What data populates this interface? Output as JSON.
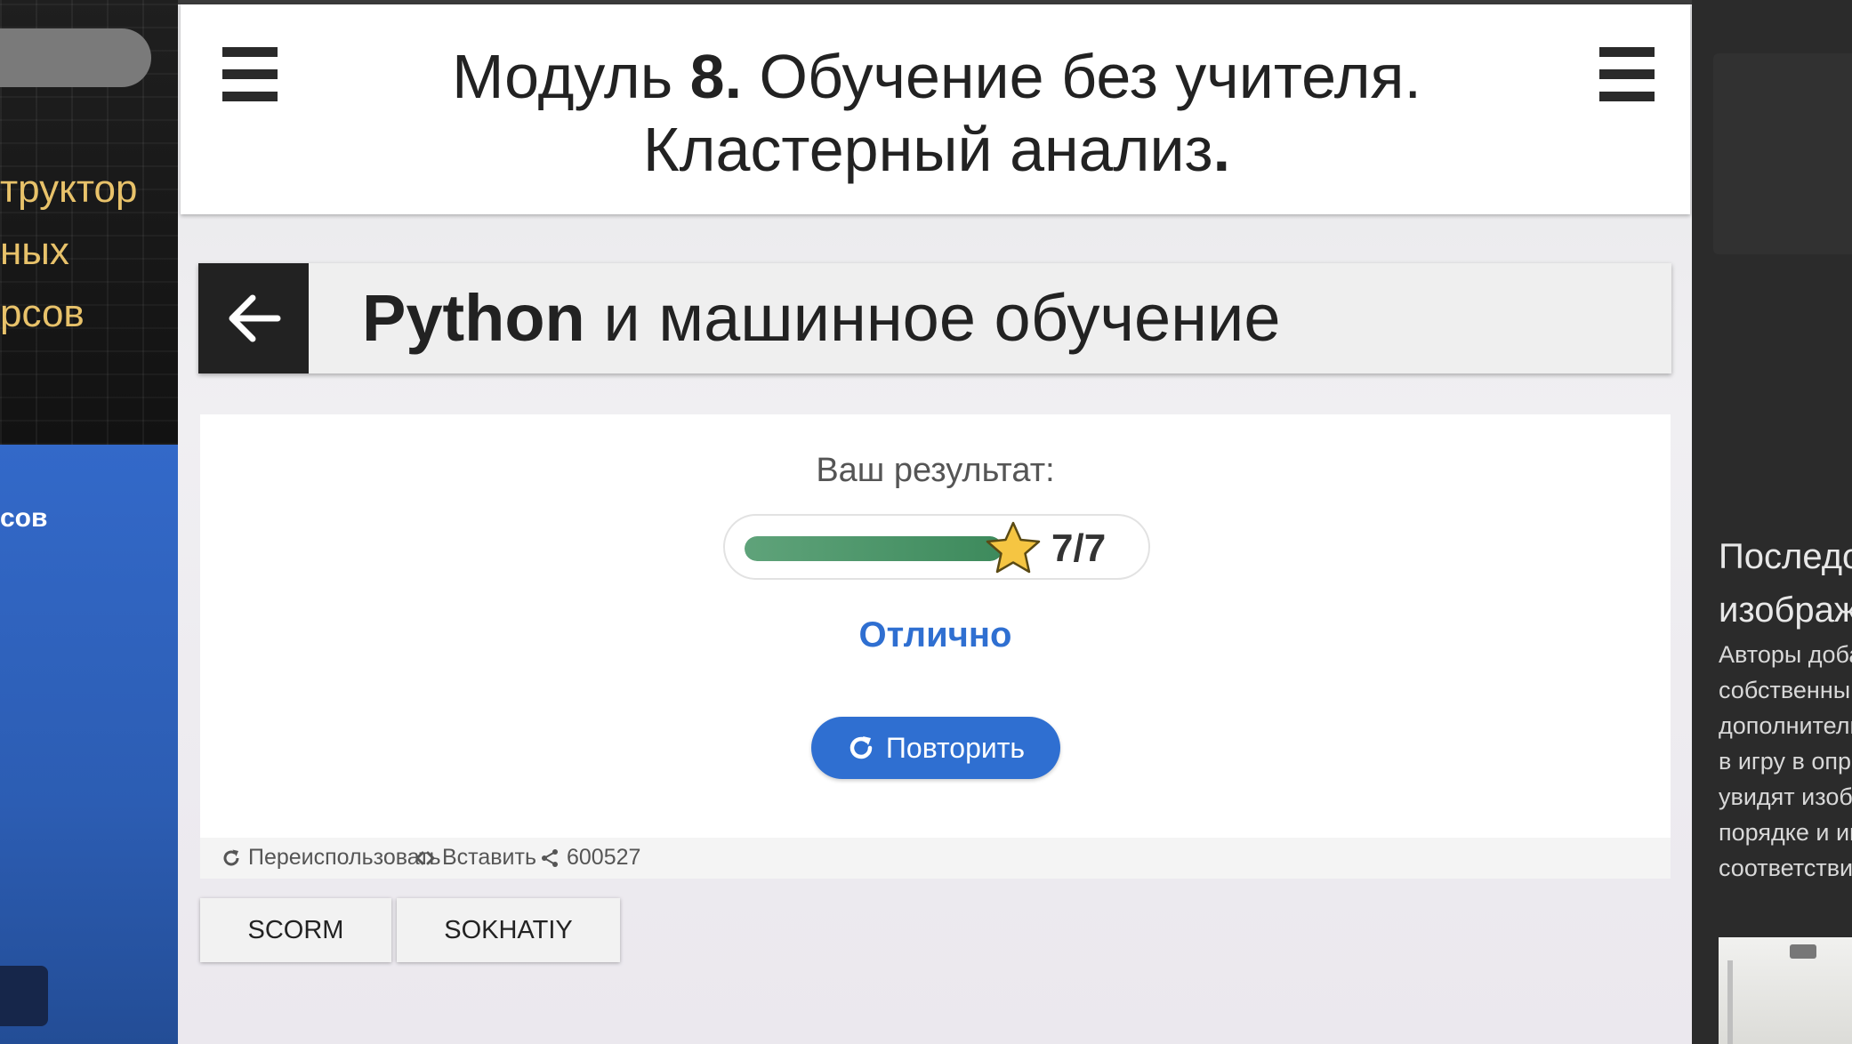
{
  "left_sidebar": {
    "hero_lines": [
      "труктор",
      "ных",
      "рсов"
    ],
    "blue_text": "сов"
  },
  "module_header": {
    "title_prefix": "Модуль ",
    "title_number": "8.",
    "title_rest": " Обучение без учителя.",
    "title_line2": "Кластерный анализ",
    "title_line2_end": "."
  },
  "course": {
    "title_bold": "Python",
    "title_rest": " и машинное обучение"
  },
  "result": {
    "label": "Ваш результат:",
    "score": "7/7",
    "progress": 1.0,
    "grade": "Отлично",
    "retry_label": "Повторить"
  },
  "footer": {
    "reuse_label": "Переиспользовать",
    "embed_label": "Вставить",
    "share_count": "600527"
  },
  "tags": [
    "SCORM",
    "SOKHATIY"
  ],
  "right_panel": {
    "heading_lines": [
      "Последо",
      "изображ"
    ],
    "text_lines": [
      "Авторы доба",
      "собственны",
      "дополнитель",
      "в игру в опре",
      "увидят изобр",
      "порядке и им",
      "соответстви"
    ]
  },
  "colors": {
    "accent_blue": "#2f6fd1",
    "progress_green": "#4a9467",
    "star_yellow": "#f5c542"
  },
  "icons": {
    "menu": "hamburger-icon",
    "back": "arrow-left-icon",
    "star": "star-icon",
    "retry": "refresh-icon",
    "reuse": "refresh-icon",
    "embed": "code-icon",
    "share": "share-icon"
  }
}
